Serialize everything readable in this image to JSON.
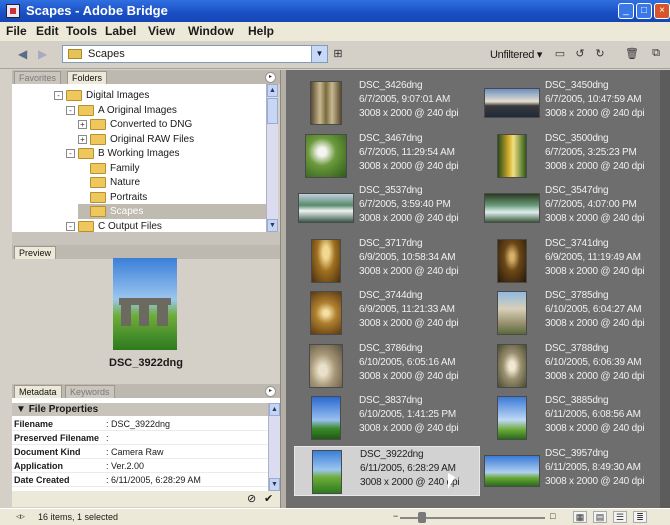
{
  "window": {
    "title": "Scapes - Adobe Bridge"
  },
  "menu": [
    "File",
    "Edit",
    "Tools",
    "Label",
    "View",
    "Window",
    "Help"
  ],
  "path": {
    "folder": "Scapes",
    "filter": "Unfiltered"
  },
  "left_tabs": {
    "favorites": "Favorites",
    "folders": "Folders"
  },
  "tree": [
    {
      "label": "Digital Images",
      "indent": 0,
      "toggle": "-"
    },
    {
      "label": "A Original Images",
      "indent": 1,
      "toggle": "-"
    },
    {
      "label": "Converted to DNG",
      "indent": 2,
      "toggle": "+"
    },
    {
      "label": "Original RAW Files",
      "indent": 2,
      "toggle": "+"
    },
    {
      "label": "B Working Images",
      "indent": 1,
      "toggle": "-"
    },
    {
      "label": "Family",
      "indent": 2,
      "toggle": ""
    },
    {
      "label": "Nature",
      "indent": 2,
      "toggle": ""
    },
    {
      "label": "Portraits",
      "indent": 2,
      "toggle": ""
    },
    {
      "label": "Scapes",
      "indent": 2,
      "toggle": "",
      "selected": true
    },
    {
      "label": "C Output Files",
      "indent": 1,
      "toggle": "-"
    }
  ],
  "preview": {
    "tab": "Preview",
    "caption": "DSC_3922dng"
  },
  "meta_tabs": {
    "metadata": "Metadata",
    "keywords": "Keywords"
  },
  "metadata": {
    "section": "File Properties",
    "rows": [
      {
        "k": "Filename",
        "v": ": DSC_3922dng"
      },
      {
        "k": "Preserved Filename",
        "v": ":"
      },
      {
        "k": "Document Kind",
        "v": ": Camera Raw"
      },
      {
        "k": "Application",
        "v": ": Ver.2.00"
      },
      {
        "k": "Date Created",
        "v": ": 6/11/2005, 6:28:29 AM"
      }
    ]
  },
  "files": [
    {
      "name": "DSC_3426dng",
      "date": "6/7/2005, 9:07:01 AM",
      "dim": "3008 x 2000 @ 240 dpi",
      "thumb": "door"
    },
    {
      "name": "DSC_3450dng",
      "date": "6/7/2005, 10:47:59 AM",
      "dim": "3008 x 2000 @ 240 dpi",
      "thumb": "pier"
    },
    {
      "name": "DSC_3467dng",
      "date": "6/7/2005, 11:29:54 AM",
      "dim": "3008 x 2000 @ 240 dpi",
      "thumb": "garden"
    },
    {
      "name": "DSC_3500dng",
      "date": "6/7/2005, 3:25:23 PM",
      "dim": "3008 x 2000 @ 240 dpi",
      "thumb": "falls"
    },
    {
      "name": "DSC_3537dng",
      "date": "6/7/2005, 3:59:40 PM",
      "dim": "3008 x 2000 @ 240 dpi",
      "thumb": "river"
    },
    {
      "name": "DSC_3547dng",
      "date": "6/7/2005, 4:07:00 PM",
      "dim": "3008 x 2000 @ 240 dpi",
      "thumb": "stream"
    },
    {
      "name": "DSC_3717dng",
      "date": "6/9/2005, 10:58:34 AM",
      "dim": "3008 x 2000 @ 240 dpi",
      "thumb": "arch"
    },
    {
      "name": "DSC_3741dng",
      "date": "6/9/2005, 11:19:49 AM",
      "dim": "3008 x 2000 @ 240 dpi",
      "thumb": "archdark"
    },
    {
      "name": "DSC_3744dng",
      "date": "6/9/2005, 11:21:33 AM",
      "dim": "3008 x 2000 @ 240 dpi",
      "thumb": "vault"
    },
    {
      "name": "DSC_3785dng",
      "date": "6/10/2005, 6:04:27 AM",
      "dim": "3008 x 2000 @ 240 dpi",
      "thumb": "ruin"
    },
    {
      "name": "DSC_3786dng",
      "date": "6/10/2005, 6:05:16 AM",
      "dim": "3008 x 2000 @ 240 dpi",
      "thumb": "cloister"
    },
    {
      "name": "DSC_3788dng",
      "date": "6/10/2005, 6:06:39 AM",
      "dim": "3008 x 2000 @ 240 dpi",
      "thumb": "cloister2"
    },
    {
      "name": "DSC_3837dng",
      "date": "6/10/2005, 1:41:25 PM",
      "dim": "3008 x 2000 @ 240 dpi",
      "thumb": "tower"
    },
    {
      "name": "DSC_3885dng",
      "date": "6/11/2005, 6:08:56 AM",
      "dim": "3008 x 2000 @ 240 dpi",
      "thumb": "sky"
    },
    {
      "name": "DSC_3922dng",
      "date": "6/11/2005, 6:28:29 AM",
      "dim": "3008 x 2000 @ 240 dpi",
      "thumb": "stones",
      "selected": true
    },
    {
      "name": "DSC_3957dng",
      "date": "6/11/2005, 8:49:30 AM",
      "dim": "3008 x 2000 @ 240 dpi",
      "thumb": "henge"
    }
  ],
  "status": {
    "text": "16 items, 1 selected"
  }
}
